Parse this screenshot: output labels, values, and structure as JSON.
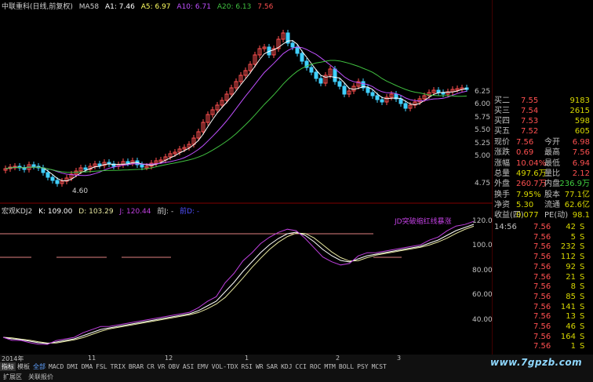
{
  "header": {
    "title": "中联重科(日线,前复权)",
    "ma_label": "MA58",
    "a1": "A1: 7.46",
    "a5": "A5: 6.97",
    "a10": "A10: 6.71",
    "a20": "A20: 6.13",
    "extra": "7.56"
  },
  "kdj": {
    "title": "宏观KDJ2",
    "k": "K: 109.00",
    "d": "D: 103.29",
    "j": "J: 120.44",
    "qian": "前J: -",
    "extra": "前D: -",
    "annotation": "JD突破缩红线暴涨"
  },
  "price_axis": [
    "6.25",
    "6.00",
    "5.75",
    "5.50",
    "5.25",
    "5.00",
    "4.75"
  ],
  "kdj_axis": [
    "120.0",
    "100.0",
    "80.00",
    "60.00",
    "40.00"
  ],
  "price_marker": "4.60",
  "date_axis": [
    "2014年",
    "11",
    "12",
    "1",
    "2",
    "3"
  ],
  "orderbook": [
    {
      "label": "买二",
      "price": "7.55",
      "vol": "9183"
    },
    {
      "label": "买三",
      "price": "7.54",
      "vol": "2615"
    },
    {
      "label": "买四",
      "price": "7.53",
      "vol": "598"
    },
    {
      "label": "买五",
      "price": "7.52",
      "vol": "605"
    }
  ],
  "stats": [
    {
      "l1": "现价",
      "v1": "7.56",
      "l2": "今开",
      "v2": "6.98",
      "c1": "#ff5050",
      "c2": "#ff5050"
    },
    {
      "l1": "涨跌",
      "v1": "0.69",
      "l2": "最高",
      "v2": "7.56",
      "c1": "#ff5050",
      "c2": "#ff5050"
    },
    {
      "l1": "涨幅",
      "v1": "10.04%",
      "l2": "最低",
      "v2": "6.94",
      "c1": "#ff5050",
      "c2": "#ff5050"
    },
    {
      "l1": "总量",
      "v1": "497.6万",
      "l2": "量比",
      "v2": "2.12",
      "c1": "#d8d800",
      "c2": "#ff5050"
    },
    {
      "l1": "外盘",
      "v1": "260.7万",
      "l2": "内盘",
      "v2": "236.9万",
      "c1": "#ff5050",
      "c2": "#40d040"
    },
    {
      "l1": "换手",
      "v1": "7.95%",
      "l2": "股本",
      "v2": "77.1亿",
      "c1": "#d8d800",
      "c2": "#d8d800"
    },
    {
      "l1": "净资",
      "v1": "5.30",
      "l2": "流通",
      "v2": "62.6亿",
      "c1": "#d8d800",
      "c2": "#d8d800"
    },
    {
      "l1": "收益(四)",
      "v1": "0.077",
      "l2": "PE(动)",
      "v2": "98.1",
      "c1": "#d8d800",
      "c2": "#d8d800"
    }
  ],
  "ticks": [
    {
      "time": "14:56",
      "price": "7.56",
      "vol": "42",
      "side": "S"
    },
    {
      "time": "",
      "price": "7.56",
      "vol": "5",
      "side": "S"
    },
    {
      "time": "",
      "price": "7.56",
      "vol": "232",
      "side": "S"
    },
    {
      "time": "",
      "price": "7.56",
      "vol": "112",
      "side": "S"
    },
    {
      "time": "",
      "price": "7.56",
      "vol": "92",
      "side": "S"
    },
    {
      "time": "",
      "price": "7.56",
      "vol": "21",
      "side": "S"
    },
    {
      "time": "",
      "price": "7.56",
      "vol": "8",
      "side": "S"
    },
    {
      "time": "",
      "price": "7.56",
      "vol": "85",
      "side": "S"
    },
    {
      "time": "",
      "price": "7.56",
      "vol": "141",
      "side": "S"
    },
    {
      "time": "",
      "price": "7.56",
      "vol": "13",
      "side": "S"
    },
    {
      "time": "",
      "price": "7.56",
      "vol": "46",
      "side": "S"
    },
    {
      "time": "",
      "price": "7.56",
      "vol": "164",
      "side": "S"
    },
    {
      "time": "",
      "price": "7.56",
      "vol": "1",
      "side": "S"
    }
  ],
  "tabs": [
    "指标",
    "模板",
    "全部",
    "MACD",
    "DMI",
    "DMA",
    "FSL",
    "TRIX",
    "BRAR",
    "CR",
    "VR",
    "OBV",
    "ASI",
    "EMV",
    "VOL-TDX",
    "RSI",
    "WR",
    "SAR",
    "KDJ",
    "CCI",
    "ROC",
    "MTM",
    "BOLL",
    "PSY",
    "MCST"
  ],
  "bottom_links": [
    "扩展区",
    "关联报价"
  ],
  "watermark": "www.7gpzb.com",
  "colors": {
    "up": "#ff5050",
    "down": "#40d0ff",
    "ma_white": "#ffffff",
    "ma_magenta": "#c050ff",
    "ma_green": "#40c040",
    "kdj_k": "#ffffff",
    "kdj_d": "#e8e8a0",
    "kdj_j": "#c040e0",
    "hline": "#e08080"
  }
}
